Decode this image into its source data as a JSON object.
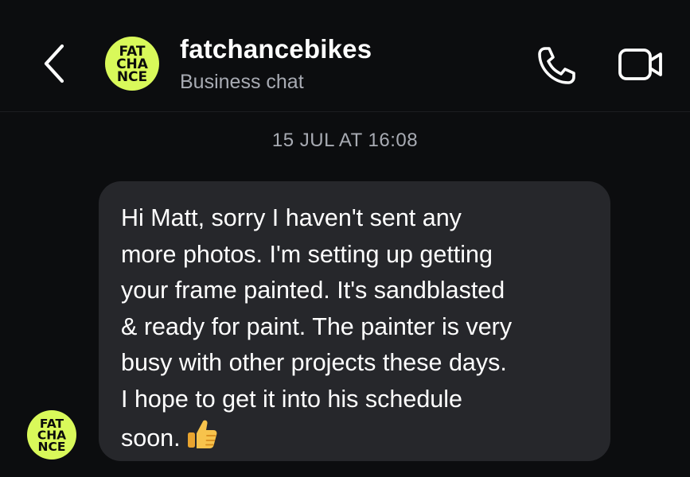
{
  "header": {
    "back_icon": "chevron-left-icon",
    "contact_name": "fatchancebikes",
    "contact_subtitle": "Business chat",
    "call_icon": "phone-icon",
    "video_icon": "video-camera-icon",
    "avatar_logo_lines": [
      "FAT",
      "CHA",
      "NCE"
    ],
    "avatar_color": "#d9f95a"
  },
  "conversation": {
    "timestamp": "15 JUL AT 16:08",
    "messages": [
      {
        "sender": "fatchancebikes",
        "lines": [
          "Hi Matt, sorry I haven't sent any",
          "more photos. I'm setting up getting",
          "your frame painted. It's sandblasted",
          "& ready for paint. The painter is very",
          "busy with other projects these days.",
          "I hope to get it into his schedule",
          "soon."
        ],
        "emoji": "thumbs-up-icon"
      }
    ]
  },
  "colors": {
    "background": "#0c0d0f",
    "bubble": "#26272b",
    "secondary_text": "#a8abb3",
    "brand": "#d9f95a"
  }
}
